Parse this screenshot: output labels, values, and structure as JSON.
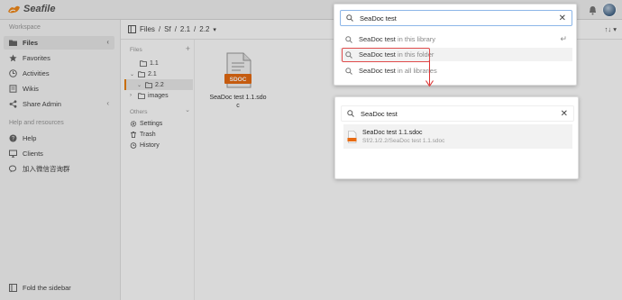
{
  "app": {
    "brand": "Seafile"
  },
  "sidebar": {
    "workspace_title": "Workspace",
    "items": [
      {
        "label": "Files",
        "active": true
      },
      {
        "label": "Favorites"
      },
      {
        "label": "Activities"
      },
      {
        "label": "Wikis"
      },
      {
        "label": "Share Admin"
      }
    ],
    "help_title": "Help and resources",
    "help_items": [
      {
        "label": "Help"
      },
      {
        "label": "Clients"
      },
      {
        "label": "加入微信咨询群"
      }
    ],
    "fold_label": "Fold the sidebar"
  },
  "breadcrumb": {
    "root": "Files",
    "sep": "/",
    "parts": [
      "Sf",
      "2.1",
      "2.2"
    ]
  },
  "view_controls": "↑↓ ▾",
  "tree": {
    "files_title": "Files",
    "nodes": [
      {
        "label": "1.1"
      },
      {
        "label": "2.1"
      },
      {
        "label": "2.2"
      },
      {
        "label": "images"
      }
    ],
    "others_title": "Others",
    "others": [
      {
        "label": "Settings"
      },
      {
        "label": "Trash"
      },
      {
        "label": "History"
      }
    ]
  },
  "file": {
    "name": "SeaDoc test 1.1.sdoc",
    "badge": "SDOC"
  },
  "search_dropdown": {
    "query": "SeaDoc test",
    "suggestions": [
      {
        "term": "SeaDoc test",
        "scope": "in this library"
      },
      {
        "term": "SeaDoc test",
        "scope": "in this folder"
      },
      {
        "term": "SeaDoc test",
        "scope": "in all libraries"
      }
    ],
    "clear_glyph": "✕",
    "enter_glyph": "↵"
  },
  "search_results": {
    "query": "SeaDoc test",
    "clear_glyph": "✕",
    "results": [
      {
        "name": "SeaDoc test 1.1.sdoc",
        "path": "Sf/2.1/2.2/SeaDoc test 1.1.sdoc"
      }
    ]
  },
  "colors": {
    "accent": "#ec8000",
    "annotation": "#e04b4b",
    "focus": "#8cb6e8"
  }
}
